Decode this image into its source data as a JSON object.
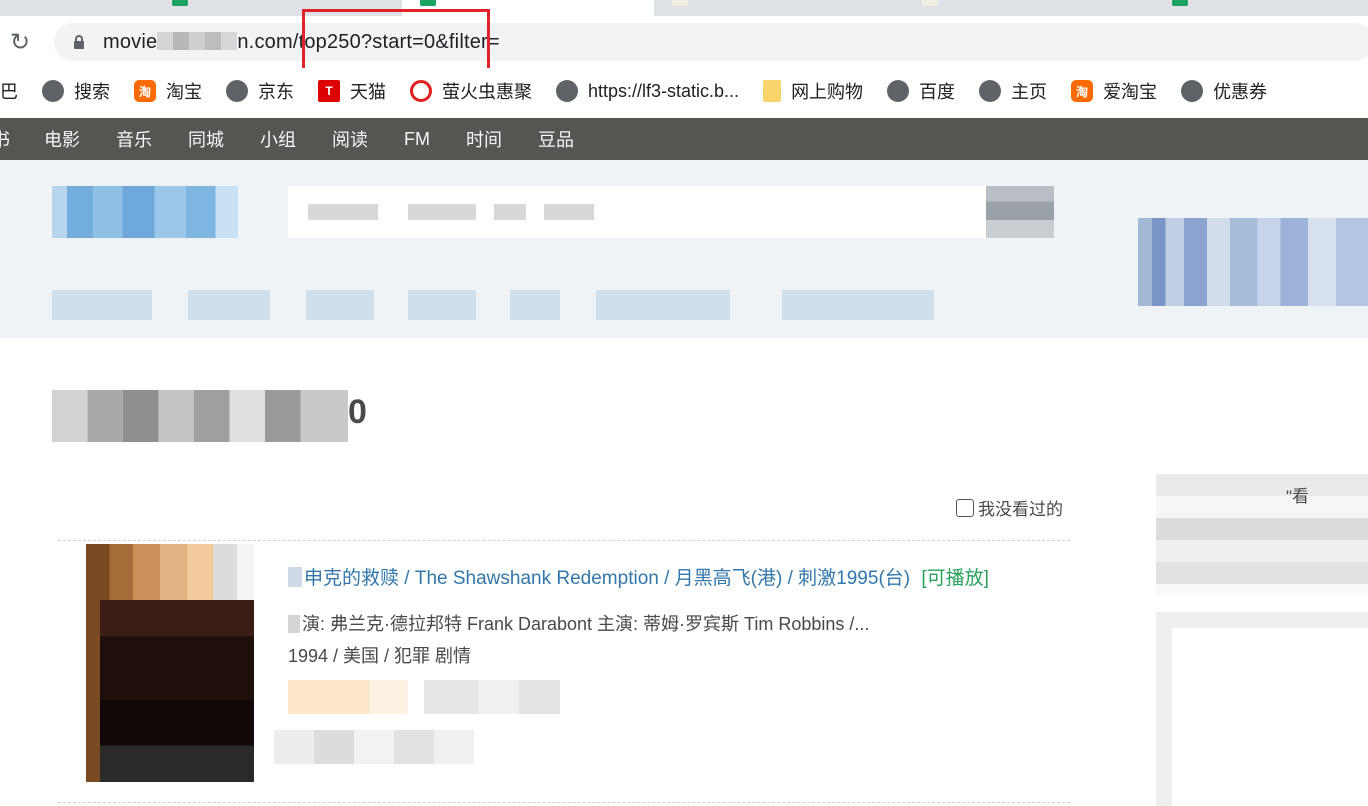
{
  "browser": {
    "url": {
      "prefix": "movie",
      "domain_suffix": "n.com",
      "path": "/top250?start=0&filter="
    },
    "bookmarks": [
      {
        "label": "巴",
        "icon": "partial-icon"
      },
      {
        "label": "搜索",
        "icon": "globe-icon"
      },
      {
        "label": "淘宝",
        "icon": "taobao-icon"
      },
      {
        "label": "京东",
        "icon": "globe-icon"
      },
      {
        "label": "天猫",
        "icon": "tmall-icon"
      },
      {
        "label": "萤火虫惠聚",
        "icon": "firefly-icon"
      },
      {
        "label": "https://lf3-static.b...",
        "icon": "globe-icon"
      },
      {
        "label": "网上购物",
        "icon": "folder-icon"
      },
      {
        "label": "百度",
        "icon": "globe-icon"
      },
      {
        "label": "主页",
        "icon": "globe-icon"
      },
      {
        "label": "爱淘宝",
        "icon": "taobao-icon"
      },
      {
        "label": "优惠券",
        "icon": "globe-icon"
      }
    ]
  },
  "site_nav": {
    "items": [
      "书",
      "电影",
      "音乐",
      "同城",
      "小组",
      "阅读",
      "FM",
      "时间",
      "豆品"
    ]
  },
  "page": {
    "title_suffix": "0",
    "unwatched_filter_label": "我没看过的"
  },
  "movie": {
    "title_cn": "申克的救赎",
    "title_en": "/ The Shawshank Redemption",
    "title_alt": "/ 月黑高飞(港) / 刺激1995(台)",
    "playable": "[可播放]",
    "credits": "演: 弗兰克·德拉邦特 Frank Darabont   主演: 蒂姆·罗宾斯 Tim Robbins /...",
    "meta": "1994 / 美国 / 犯罪 剧情"
  },
  "sidebar": {
    "snippet": "\"看"
  },
  "colors": {
    "nav_bg": "#545652",
    "link": "#3377aa",
    "playable": "#2aa15e",
    "highlight": "#e0222b"
  }
}
